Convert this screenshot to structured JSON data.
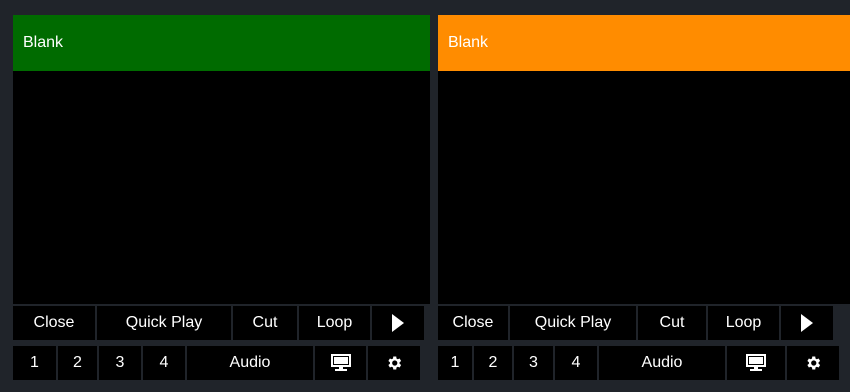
{
  "players": [
    {
      "title": "Blank",
      "title_color": "#006b00",
      "buttons_row1": [
        "Close",
        "Quick Play",
        "Cut",
        "Loop"
      ],
      "buttons_row2": [
        "1",
        "2",
        "3",
        "4",
        "Audio"
      ],
      "play_icon": "play-icon",
      "monitor_icon": "monitor-icon",
      "settings_icon": "gear-icon"
    },
    {
      "title": "Blank",
      "title_color": "#ff8c00",
      "buttons_row1": [
        "Close",
        "Quick Play",
        "Cut",
        "Loop"
      ],
      "buttons_row2": [
        "1",
        "2",
        "3",
        "4",
        "Audio"
      ],
      "play_icon": "play-icon",
      "monitor_icon": "monitor-icon",
      "settings_icon": "gear-icon"
    }
  ]
}
